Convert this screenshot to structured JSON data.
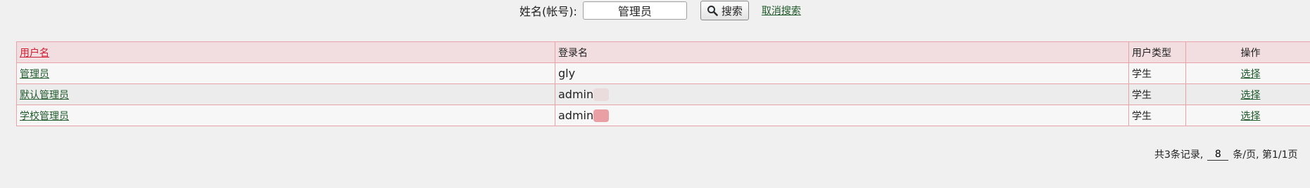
{
  "search": {
    "label": "姓名(帐号):",
    "value": "管理员",
    "button_label": "搜索",
    "cancel_label": "取消搜索"
  },
  "table": {
    "columns": [
      "用户名",
      "登录名",
      "用户类型",
      "操作"
    ],
    "rows": [
      {
        "username": "管理员",
        "login": "gly",
        "type": "学生",
        "action": "选择"
      },
      {
        "username": "默认管理员",
        "login": "admin",
        "type": "学生",
        "action": "选择"
      },
      {
        "username": "学校管理员",
        "login": "admin",
        "type": "学生",
        "action": "选择"
      }
    ]
  },
  "pager": {
    "total_prefix": "共3条记录,",
    "page_size": "8",
    "page_suffix": "条/页, 第1/1页"
  },
  "colors": {
    "border": "#e8a3a8",
    "header_bg": "#f2dde0",
    "link": "#1e5a2a",
    "sort_link": "#cc1f2f"
  },
  "icons": {
    "search_button": "magnifier-icon"
  }
}
